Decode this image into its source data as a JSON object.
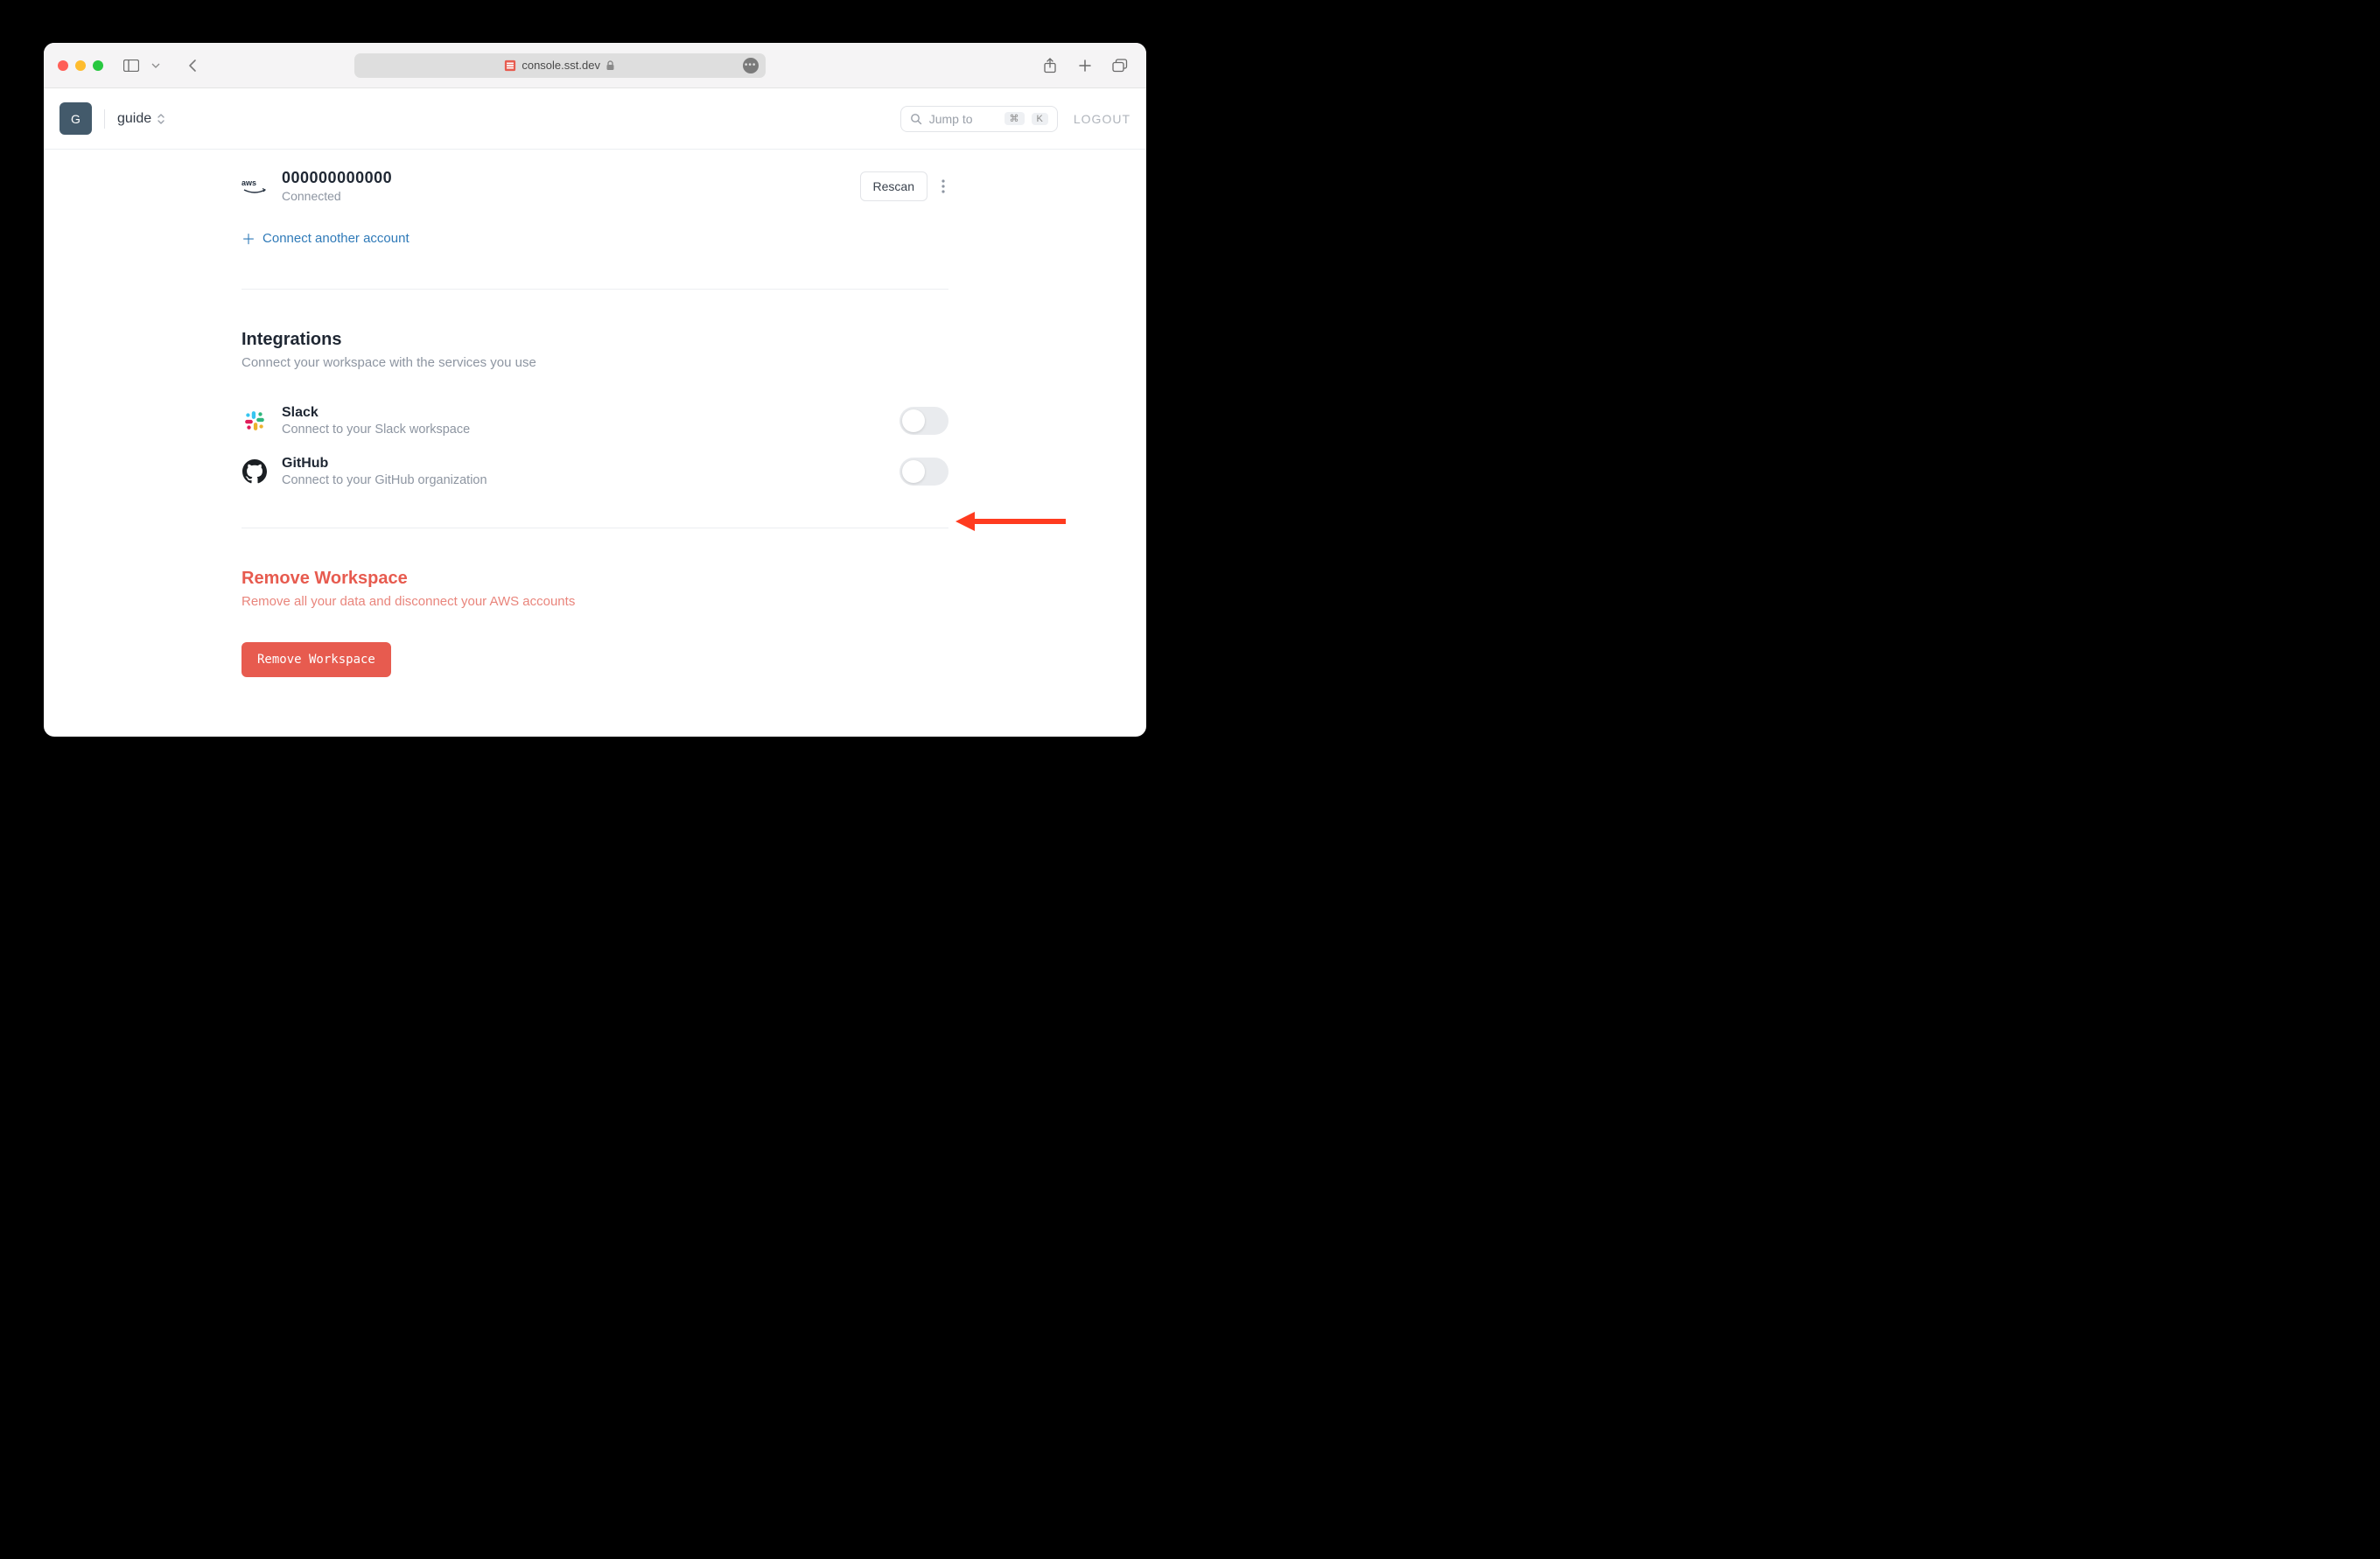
{
  "browser": {
    "url": "console.sst.dev"
  },
  "header": {
    "avatar_letter": "G",
    "workspace": "guide",
    "jump_to": "Jump to",
    "kbd_cmd": "⌘",
    "kbd_k": "K",
    "logout": "LOGOUT"
  },
  "aws": {
    "account_id": "000000000000",
    "status": "Connected",
    "rescan": "Rescan",
    "connect_another": "Connect another account"
  },
  "integrations": {
    "title": "Integrations",
    "subtitle": "Connect your workspace with the services you use",
    "slack": {
      "title": "Slack",
      "desc": "Connect to your Slack workspace"
    },
    "github": {
      "title": "GitHub",
      "desc": "Connect to your GitHub organization"
    }
  },
  "danger": {
    "title": "Remove Workspace",
    "subtitle": "Remove all your data and disconnect your AWS accounts",
    "button": "Remove Workspace"
  }
}
